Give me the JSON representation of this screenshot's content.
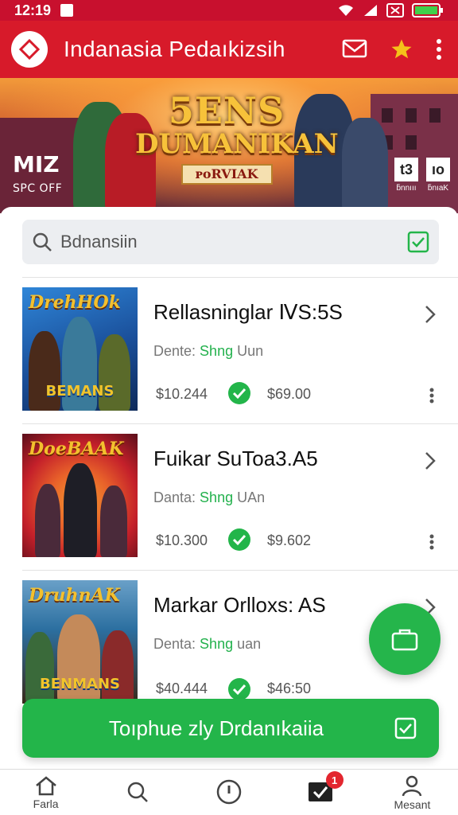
{
  "status_bar": {
    "time": "12:19"
  },
  "app_bar": {
    "title": "Indanasia Pedaıkizsih"
  },
  "banner": {
    "title_line1": "5ENS",
    "title_line2": "DUMANIKAN",
    "subtitle": "ᴘoRVIAK",
    "brand_left": "MIZ",
    "brand_left_sub": "SPC OFF",
    "brand_right_1": "t3",
    "brand_right_1_cap": "ƃnnııı",
    "brand_right_2": "ıo",
    "brand_right_2_cap": "ƃnıaK"
  },
  "search": {
    "value": "Bdnansiin"
  },
  "products": [
    {
      "title": "Rellasninglar ⅣS:5S",
      "sub_prefix": "Dente: ",
      "sub_accent": "Shng",
      "sub_suffix": " Uun",
      "price1": "$10.244",
      "price2": "$69.00",
      "thumb_title": "DrehHOk",
      "thumb_bottom": "BEMANS",
      "colors": [
        "#1a4f9a",
        "#2f86d8",
        "#0e2a5a"
      ]
    },
    {
      "title": "Fuikar SuToa3.A5",
      "sub_prefix": "Danta: ",
      "sub_accent": "Shng",
      "sub_suffix": " UAn",
      "price1": "$10.300",
      "price2": "$9.602",
      "thumb_title": "DoeBAAK",
      "thumb_bottom": "",
      "colors": [
        "#e8612a",
        "#c4202a",
        "#5a0e1a"
      ]
    },
    {
      "title": "Markar Orlloxs: AS",
      "sub_prefix": "Denta: ",
      "sub_accent": "Shng",
      "sub_suffix": " uan",
      "price1": "$40.444",
      "price2": "$46:50",
      "thumb_title": "DruhnAK",
      "thumb_bottom": "BENMANS",
      "colors": [
        "#2c6fa0",
        "#6aa0c8",
        "#3a2a1a"
      ]
    }
  ],
  "cta": {
    "label": "Toıphue zly Drdanıkaiia"
  },
  "bottom_nav": [
    {
      "label": "Farla",
      "icon": "home-icon"
    },
    {
      "label": "",
      "icon": "search-icon"
    },
    {
      "label": "",
      "icon": "info-icon"
    },
    {
      "label": "",
      "icon": "checklist-icon",
      "badge": "1"
    },
    {
      "label": "Mesant",
      "icon": "profile-icon"
    }
  ],
  "colors": {
    "primary_red": "#d71a2a",
    "accent_green": "#23b54a",
    "star_yellow": "#f5c11a"
  }
}
